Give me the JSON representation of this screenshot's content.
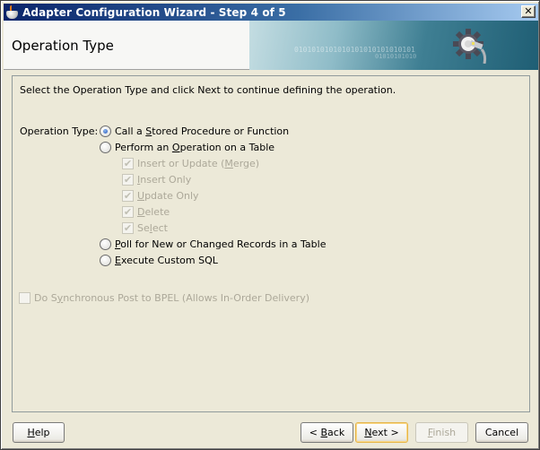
{
  "window": {
    "title": "Adapter Configuration Wizard - Step 4 of 5",
    "close_glyph": "✕",
    "app_icon": "java-cup-icon"
  },
  "header": {
    "title": "Operation Type",
    "banner_binary_1": "0101010101010101010101010101",
    "banner_binary_2": "01010101010",
    "banner_icon": "gear-plug-icon"
  },
  "content": {
    "instruction": "Select the Operation Type and click Next to continue defining the operation.",
    "operation_type_label": "Operation Type:",
    "options": [
      {
        "label_pre": "Call a ",
        "mnemonic": "S",
        "label_post": "tored Procedure or Function",
        "checked": true
      },
      {
        "label_pre": "Perform an ",
        "mnemonic": "O",
        "label_post": "peration on a Table",
        "checked": false
      },
      {
        "label_pre": "",
        "mnemonic": "P",
        "label_post": "oll for New or Changed Records in a Table",
        "checked": false
      },
      {
        "label_pre": "",
        "mnemonic": "E",
        "label_post": "xecute Custom SQL",
        "checked": false
      }
    ],
    "table_ops": [
      {
        "label_pre": "Insert or Update (",
        "mnemonic": "M",
        "label_post": "erge)",
        "checked": true,
        "enabled": false
      },
      {
        "label_pre": "",
        "mnemonic": "I",
        "label_post": "nsert Only",
        "checked": true,
        "enabled": false
      },
      {
        "label_pre": "",
        "mnemonic": "U",
        "label_post": "pdate Only",
        "checked": true,
        "enabled": false
      },
      {
        "label_pre": "",
        "mnemonic": "D",
        "label_post": "elete",
        "checked": true,
        "enabled": false
      },
      {
        "label_pre": "Se",
        "mnemonic": "l",
        "label_post": "ect",
        "checked": true,
        "enabled": false
      }
    ],
    "sync_post": {
      "label_pre": "Do S",
      "mnemonic": "y",
      "label_post": "nchronous Post to BPEL (Allows In-Order Delivery)",
      "checked": false,
      "enabled": false
    },
    "check_glyph": "✔"
  },
  "footer": {
    "help": {
      "mnemonic": "H",
      "post": "elp"
    },
    "back": {
      "pre": "< ",
      "mnemonic": "B",
      "post": "ack"
    },
    "next": {
      "mnemonic": "N",
      "post": "ext >"
    },
    "finish": {
      "mnemonic": "F",
      "post": "inish",
      "enabled": false
    },
    "cancel": {
      "label": "Cancel"
    }
  }
}
